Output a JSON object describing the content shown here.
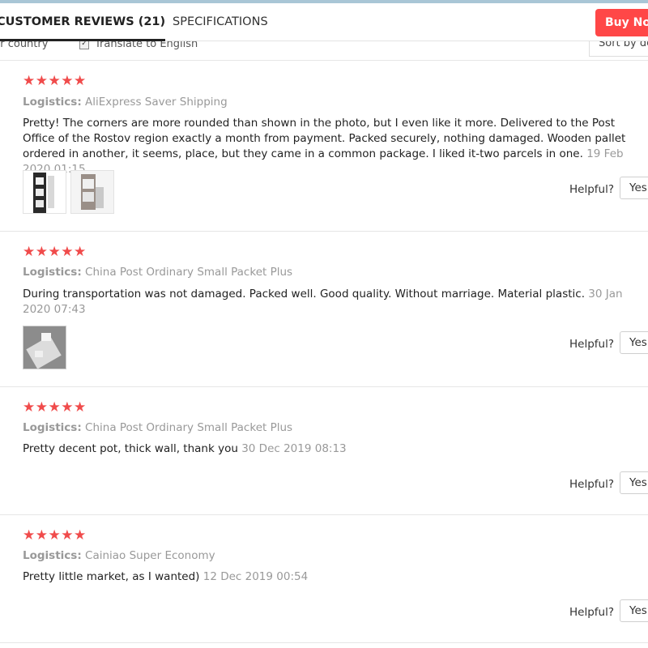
{
  "tabs": {
    "reviews": "CUSTOMER REVIEWS (21)",
    "specs": "SPECIFICATIONS",
    "buy_now": "Buy Now"
  },
  "filters": {
    "country": "ur country",
    "translate": "Translate to English",
    "sort": "Sort by de"
  },
  "logistics_label": "Logistics:",
  "helpful_label": "Helpful?",
  "yes_label": "Yes",
  "stars": "★★★★★",
  "reviews": [
    {
      "logistics": "AliExpress Saver Shipping",
      "text": "Pretty! The corners are more rounded than shown in the photo, but I even like it more. Delivered to the Post Office of the Rostov region exactly a month from payment. Packed securely, nothing damaged. Wooden pallet ordered in another, it seems, place, but they came in a common package. I liked it-two parcels in one.",
      "date": "19 Feb 2020 01:15",
      "photos": [
        "photo-1",
        "photo-2"
      ]
    },
    {
      "logistics": "China Post Ordinary Small Packet Plus",
      "text": "During transportation was not damaged. Packed well. Good quality. Without marriage. Material plastic.",
      "date": "30 Jan 2020 07:43",
      "photos": [
        "photo-1"
      ]
    },
    {
      "logistics": "China Post Ordinary Small Packet Plus",
      "text": "Pretty decent pot, thick wall, thank you",
      "date": "30 Dec 2019 08:13",
      "photos": []
    },
    {
      "logistics": "Cainiao Super Economy",
      "text": "Pretty little market, as I wanted)",
      "date": "12 Dec 2019 00:54",
      "photos": []
    }
  ]
}
